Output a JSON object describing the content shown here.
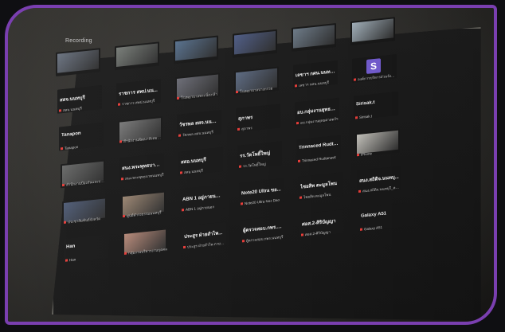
{
  "scene": {
    "app_label": "Recording"
  },
  "tiles": [
    {
      "name": "",
      "caption": "",
      "thumb": "#6b7483"
    },
    {
      "name": "",
      "caption": "",
      "thumb": "#7a7f7a"
    },
    {
      "name": "",
      "caption": "",
      "thumb": "#587392"
    },
    {
      "name": "",
      "caption": "",
      "thumb": "#4f5e8a"
    },
    {
      "name": "",
      "caption": "",
      "thumb": "#6f7d8b"
    },
    {
      "name": "",
      "caption": "",
      "thumb": "#a6b5c0"
    },
    {
      "name": "สสจ.นนทบุรี",
      "caption": "สสจ.นนทบุรี",
      "thumb": ""
    },
    {
      "name": "ราชการ สพป.นน...",
      "caption": "ราชการ สพป.นนทบุรี",
      "thumb": ""
    },
    {
      "name": "",
      "caption": "โรงพยาบาลพระนั่งเกล้า",
      "thumb": "#6e6f79"
    },
    {
      "name": "",
      "caption": "โรงพยาบาลบางกรวย",
      "thumb": "#5e6d86"
    },
    {
      "name": "เลขาฯ กศน.นนทบุรี",
      "caption": "เลขาฯ กศน.นนทบุรี",
      "thumb": ""
    },
    {
      "name": "S",
      "caption": "องค์การบริหารส่วนจังหวัด นนทบ...",
      "thumb": "",
      "avatar": "S"
    },
    {
      "name": "Tanapon",
      "caption": "Tanapon",
      "thumb": ""
    },
    {
      "name": "",
      "caption": "สำนักงานพัฒนาสังคมและความมั่นคง",
      "thumb": "#7c7c7c"
    },
    {
      "name": "วัชรพล สสจ.นนทบุรี",
      "caption": "วัชรพล สสจ.นนทบุรี",
      "thumb": ""
    },
    {
      "name": "สุภาพร",
      "caption": "สุภาพร",
      "thumb": ""
    },
    {
      "name": "อบ.กลุ่มงานยุทธศ...",
      "caption": "อบ.กลุ่มงานยุทธศาสตร์ฯ",
      "thumb": ""
    },
    {
      "name": "Sirisak.t",
      "caption": "Sirisak.t",
      "thumb": ""
    },
    {
      "name": "",
      "caption": "สำนักงานป้องกันและบรรเทา",
      "thumb": "#6a6b6a"
    },
    {
      "name": "สนง.พระพุทธบาท...",
      "caption": "สนง.พระพุทธบาทนนทบุรี",
      "thumb": ""
    },
    {
      "name": "สสอ.นนทบุรี",
      "caption": "สสอ.นนทบุรี",
      "thumb": ""
    },
    {
      "name": "รร.วัดโพธิ์ใหญ่",
      "caption": "รร.วัดโพธิ์ใหญ่",
      "thumb": ""
    },
    {
      "name": "Trinnaced Rudta...",
      "caption": "Trinnaced Rudtanavit",
      "thumb": ""
    },
    {
      "name": "",
      "caption": "iPhone",
      "thumb": "#c9c7c0"
    },
    {
      "name": "",
      "caption": "ประชาสัมพันธ์จังหวัด",
      "thumb": "#4f5d7a"
    },
    {
      "name": "",
      "caption": "ศูนย์ดำรงธรรมนนทบุรี",
      "thumb": "#a08974"
    },
    {
      "name": "ABN 1 อยู่ภายนอ...",
      "caption": "ABN 1 อยู่ภายนอก",
      "thumb": ""
    },
    {
      "name": "Note20 Ultra ขอ...",
      "caption": "Note20 Ultra ของ Dao",
      "thumb": ""
    },
    {
      "name": "ไชยสิท ตะมูลโพน",
      "caption": "ไชยสิท ตะมูลโพน",
      "thumb": ""
    },
    {
      "name": "สนง.สถิติจ.นนทบุ...",
      "caption": "สนง.สถิติจ.นนทบุรี_คณะ...",
      "thumb": ""
    },
    {
      "name": "Han",
      "caption": "Han",
      "thumb": ""
    },
    {
      "name": "",
      "caption": "กลุ่มงานบริหารงานบุคคล",
      "thumb": "#bf8e7c"
    },
    {
      "name": "ประสูร ฝ่ายสำไพ...",
      "caption": "ประสูร ฝ่ายสำไพ ภายนอก",
      "thumb": ""
    },
    {
      "name": "ผู้ตรวจสอบ.กพร.น...",
      "caption": "ผู้ตรวจสอบ.กพร.นนทบุรี",
      "thumb": ""
    },
    {
      "name": "ศอส.2-ศิริบัญญา",
      "caption": "ศอส.2-ศิริบัญญา",
      "thumb": ""
    },
    {
      "name": "Galaxy A51",
      "caption": "Galaxy A51",
      "thumb": ""
    }
  ],
  "colors": {
    "frame_border": "#7a3fb0",
    "mic_muted": "#e53935"
  }
}
